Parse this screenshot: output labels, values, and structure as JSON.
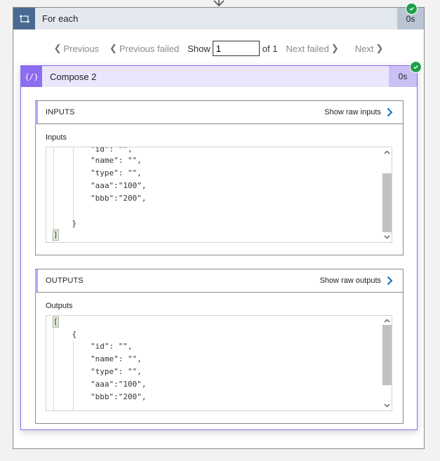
{
  "foreach": {
    "title": "For each",
    "duration": "0s",
    "status": "succeeded",
    "icon": "loop-icon",
    "pager": {
      "previous_label": "Previous",
      "previous_failed_label": "Previous failed",
      "show_label": "Show",
      "current_value": "1",
      "of_label": "of 1",
      "next_failed_label": "Next failed",
      "next_label": "Next"
    }
  },
  "compose": {
    "title": "Compose 2",
    "duration": "0s",
    "status": "succeeded",
    "icon": "compose-icon",
    "inputs": {
      "section_title": "INPUTS",
      "raw_link_label": "Show raw inputs",
      "field_label": "Inputs",
      "code_lines": [
        "        \"id\": \"\",",
        "        \"name\": \"\",",
        "        \"type\": \"\",",
        "        \"aaa\":\"100\",",
        "        \"bbb\":\"200\",",
        "",
        "    }",
        "]"
      ],
      "scroll_position": 0.75
    },
    "outputs": {
      "section_title": "OUTPUTS",
      "raw_link_label": "Show raw outputs",
      "field_label": "Outputs",
      "code_lines": [
        "[",
        "    {",
        "        \"id\": \"\",",
        "        \"name\": \"\",",
        "        \"type\": \"\",",
        "        \"aaa\":\"100\",",
        "        \"bbb\":\"200\","
      ],
      "scroll_position": 0.0
    }
  },
  "colors": {
    "foreach_accent": "#486991",
    "compose_accent": "#8c6cf0",
    "success": "#1e9e4a",
    "link_chevron": "#0f6cbd"
  }
}
